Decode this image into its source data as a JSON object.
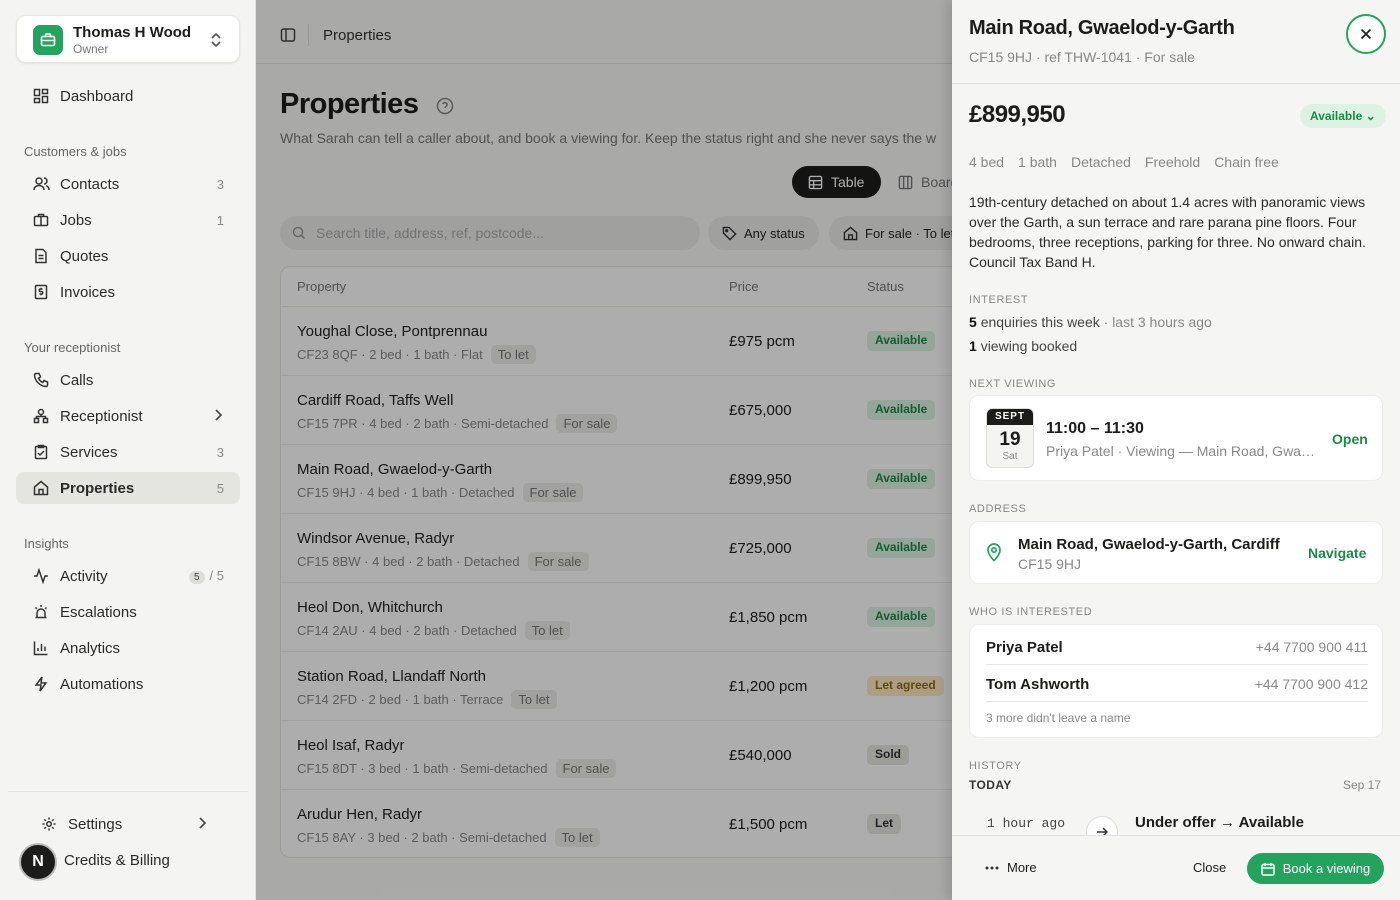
{
  "account": {
    "name": "Thomas H Wood",
    "role": "Owner"
  },
  "nav": {
    "dashboard": "Dashboard",
    "section_customers": "Customers & jobs",
    "contacts": {
      "label": "Contacts",
      "count": "3"
    },
    "jobs": {
      "label": "Jobs",
      "count": "1"
    },
    "quotes": "Quotes",
    "invoices": "Invoices",
    "section_receptionist": "Your receptionist",
    "calls": "Calls",
    "receptionist": "Receptionist",
    "services": {
      "label": "Services",
      "count": "3"
    },
    "properties": {
      "label": "Properties",
      "count": "5"
    },
    "section_insights": "Insights",
    "activity": {
      "label": "Activity",
      "badge": "5",
      "sep": "/",
      "count": "5"
    },
    "escalations": "Escalations",
    "analytics": "Analytics",
    "automations": "Automations",
    "settings": "Settings",
    "credits": "Credits & Billing",
    "avatar_letter": "N"
  },
  "topbar": {
    "breadcrumb": "Properties"
  },
  "page": {
    "title": "Properties",
    "subtitle": "What Sarah can tell a caller about, and book a viewing for. Keep the status right and she never says the w",
    "view_table": "Table",
    "view_board": "Board",
    "search_placeholder": "Search title, address, ref, postcode...",
    "filter_status": "Any status",
    "filter_type": "For sale · To let"
  },
  "table": {
    "headers": {
      "property": "Property",
      "price": "Price",
      "status": "Status"
    },
    "rows": [
      {
        "title": "Youghal Close, Pontprennau",
        "meta": "CF23 8QF · 2 bed · 1 bath · Flat",
        "tag": "To let",
        "price": "£975 pcm",
        "status": "Available",
        "status_key": "available"
      },
      {
        "title": "Cardiff Road, Taffs Well",
        "meta": "CF15 7PR · 4 bed · 2 bath · Semi-detached",
        "tag": "For sale",
        "price": "£675,000",
        "status": "Available",
        "status_key": "available"
      },
      {
        "title": "Main Road, Gwaelod-y-Garth",
        "meta": "CF15 9HJ · 4 bed · 1 bath · Detached",
        "tag": "For sale",
        "price": "£899,950",
        "status": "Available",
        "status_key": "available"
      },
      {
        "title": "Windsor Avenue, Radyr",
        "meta": "CF15 8BW · 4 bed · 2 bath · Detached",
        "tag": "For sale",
        "price": "£725,000",
        "status": "Available",
        "status_key": "available"
      },
      {
        "title": "Heol Don, Whitchurch",
        "meta": "CF14 2AU · 4 bed · 2 bath · Detached",
        "tag": "To let",
        "price": "£1,850 pcm",
        "status": "Available",
        "status_key": "available"
      },
      {
        "title": "Station Road, Llandaff North",
        "meta": "CF14 2FD · 2 bed · 1 bath · Terrace",
        "tag": "To let",
        "price": "£1,200 pcm",
        "status": "Let agreed",
        "status_key": "let-agreed"
      },
      {
        "title": "Heol Isaf, Radyr",
        "meta": "CF15 8DT · 3 bed · 1 bath · Semi-detached",
        "tag": "For sale",
        "price": "£540,000",
        "status": "Sold",
        "status_key": "sold"
      },
      {
        "title": "Arudur Hen, Radyr",
        "meta": "CF15 8AY · 3 bed · 2 bath · Semi-detached",
        "tag": "To let",
        "price": "£1,500 pcm",
        "status": "Let",
        "status_key": "let"
      }
    ]
  },
  "drawer": {
    "title": "Main Road, Gwaelod-y-Garth",
    "subtitle": "CF15 9HJ · ref THW-1041 · For sale",
    "price": "£899,950",
    "status": "Available ⌄",
    "facts": [
      "4 bed",
      "1 bath",
      "Detached",
      "Freehold",
      "Chain free"
    ],
    "description": "19th-century detached on about 1.4 acres with panoramic views over the Garth, a sun terrace and rare parana pine floors. Four bedrooms, three receptions, parking for three. No onward chain. Council Tax Band H.",
    "interest_label": "INTEREST",
    "enquiries_count": "5",
    "enquiries_text": "enquiries this week",
    "enquiries_last": "· last 3 hours ago",
    "viewing_count": "1",
    "viewing_text": "viewing booked",
    "next_viewing_label": "NEXT VIEWING",
    "viewing": {
      "month": "SEPT",
      "day": "19",
      "weekday": "Sat",
      "time": "11:00 – 11:30",
      "desc": "Priya Patel · Viewing — Main Road, Gwaelod-y-Garth",
      "action": "Open"
    },
    "address_label": "ADDRESS",
    "address": {
      "line1": "Main Road, Gwaelod-y-Garth, Cardiff",
      "postcode": "CF15 9HJ",
      "action": "Navigate"
    },
    "interested_label": "WHO IS INTERESTED",
    "interested": [
      {
        "name": "Priya Patel",
        "phone": "+44 7700 900 411"
      },
      {
        "name": "Tom Ashworth",
        "phone": "+44 7700 900 412"
      }
    ],
    "interested_more": "3 more didn't leave a name",
    "history_label": "HISTORY",
    "history_today": "TODAY",
    "history_date": "Sep 17",
    "history_item": {
      "time": "1 hour ago",
      "change": "Under offer → Available"
    },
    "footer": {
      "more": "More",
      "close": "Close",
      "book": "Book a viewing"
    }
  },
  "colors": {
    "accent": "#22a45d",
    "available_bg": "#dcf3e4",
    "available_text": "#1a8a48",
    "let_agreed_bg": "#fbe9c4"
  }
}
